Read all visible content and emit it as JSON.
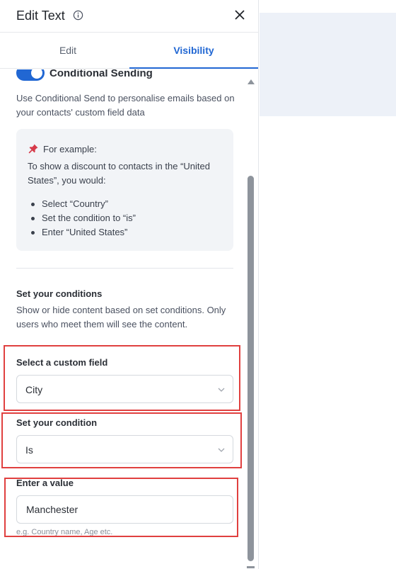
{
  "panel": {
    "title": "Edit Text",
    "tabs": [
      {
        "label": "Edit",
        "active": false
      },
      {
        "label": "Visibility",
        "active": true
      }
    ]
  },
  "conditional_send": {
    "toggle_on": true,
    "toggle_label": "Conditional Sending",
    "description": "Use Conditional Send to personalise emails based on your contacts' custom field data"
  },
  "example": {
    "heading": "For example:",
    "intro": "To show a discount to contacts in the “United States”, you would:",
    "steps": [
      "Select “Country”",
      "Set the condition to “is”",
      "Enter “United States”"
    ]
  },
  "conditions": {
    "title": "Set your conditions",
    "description": "Show or hide content based on set conditions. Only users who meet them will see the content.",
    "custom_field": {
      "label": "Select a custom field",
      "value": "City"
    },
    "condition": {
      "label": "Set your condition",
      "value": "Is"
    },
    "value_field": {
      "label": "Enter a value",
      "value": "Manchester",
      "hint": "e.g. Country name, Age etc."
    }
  },
  "colors": {
    "accent": "#2167d3",
    "highlight": "#e0403f",
    "example_bg": "#f2f4f7",
    "canvas_bg": "#edf1f8"
  },
  "icons": {
    "info": "info-icon",
    "close": "close-icon",
    "pin": "pushpin-icon",
    "chevron": "chevron-down-icon"
  }
}
